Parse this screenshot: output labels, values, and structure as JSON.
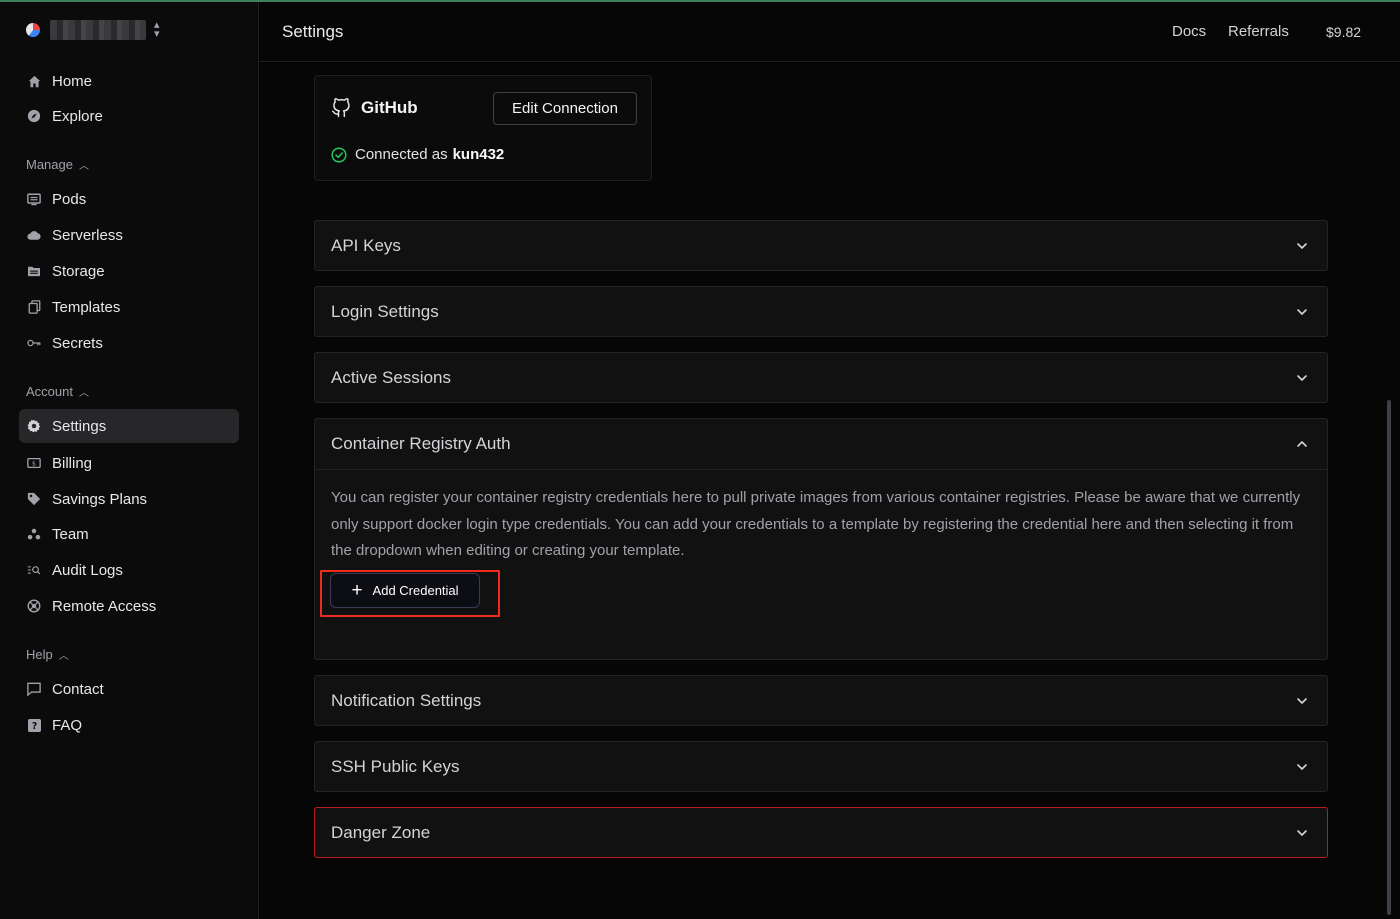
{
  "header": {
    "title": "Settings",
    "links": [
      "Docs",
      "Referrals"
    ],
    "balance": "$9.82"
  },
  "sidebar": {
    "top": [
      {
        "label": "Home",
        "icon": "home-icon"
      },
      {
        "label": "Explore",
        "icon": "compass-icon"
      }
    ],
    "sections": [
      {
        "label": "Manage",
        "items": [
          {
            "label": "Pods",
            "icon": "monitor-icon"
          },
          {
            "label": "Serverless",
            "icon": "cloud-icon"
          },
          {
            "label": "Storage",
            "icon": "storage-icon"
          },
          {
            "label": "Templates",
            "icon": "template-icon"
          },
          {
            "label": "Secrets",
            "icon": "key-icon"
          }
        ]
      },
      {
        "label": "Account",
        "items": [
          {
            "label": "Settings",
            "icon": "gear-icon",
            "active": true
          },
          {
            "label": "Billing",
            "icon": "billing-icon"
          },
          {
            "label": "Savings Plans",
            "icon": "tag-icon"
          },
          {
            "label": "Team",
            "icon": "team-icon"
          },
          {
            "label": "Audit Logs",
            "icon": "audit-icon"
          },
          {
            "label": "Remote Access",
            "icon": "globe-icon"
          }
        ]
      },
      {
        "label": "Help",
        "items": [
          {
            "label": "Contact",
            "icon": "chat-icon"
          },
          {
            "label": "FAQ",
            "icon": "question-icon"
          }
        ]
      }
    ]
  },
  "github": {
    "title": "GitHub",
    "edit_label": "Edit Connection",
    "status_prefix": "Connected as",
    "username": "kun432"
  },
  "accordions": {
    "api_keys": "API Keys",
    "login_settings": "Login Settings",
    "active_sessions": "Active Sessions",
    "container_registry": {
      "title": "Container Registry Auth",
      "description": "You can register your container registry credentials here to pull private images from various container registries. Please be aware that we currently only support docker login type credentials. You can add your credentials to a template by registering the credential here and then selecting it from the dropdown when editing or creating your template.",
      "add_label": "Add Credential"
    },
    "notification_settings": "Notification Settings",
    "ssh_keys": "SSH Public Keys",
    "danger_zone": "Danger Zone"
  },
  "colors": {
    "accent_green": "#22c55e",
    "danger": "#b91c1c",
    "highlight": "#ef2b1f"
  }
}
